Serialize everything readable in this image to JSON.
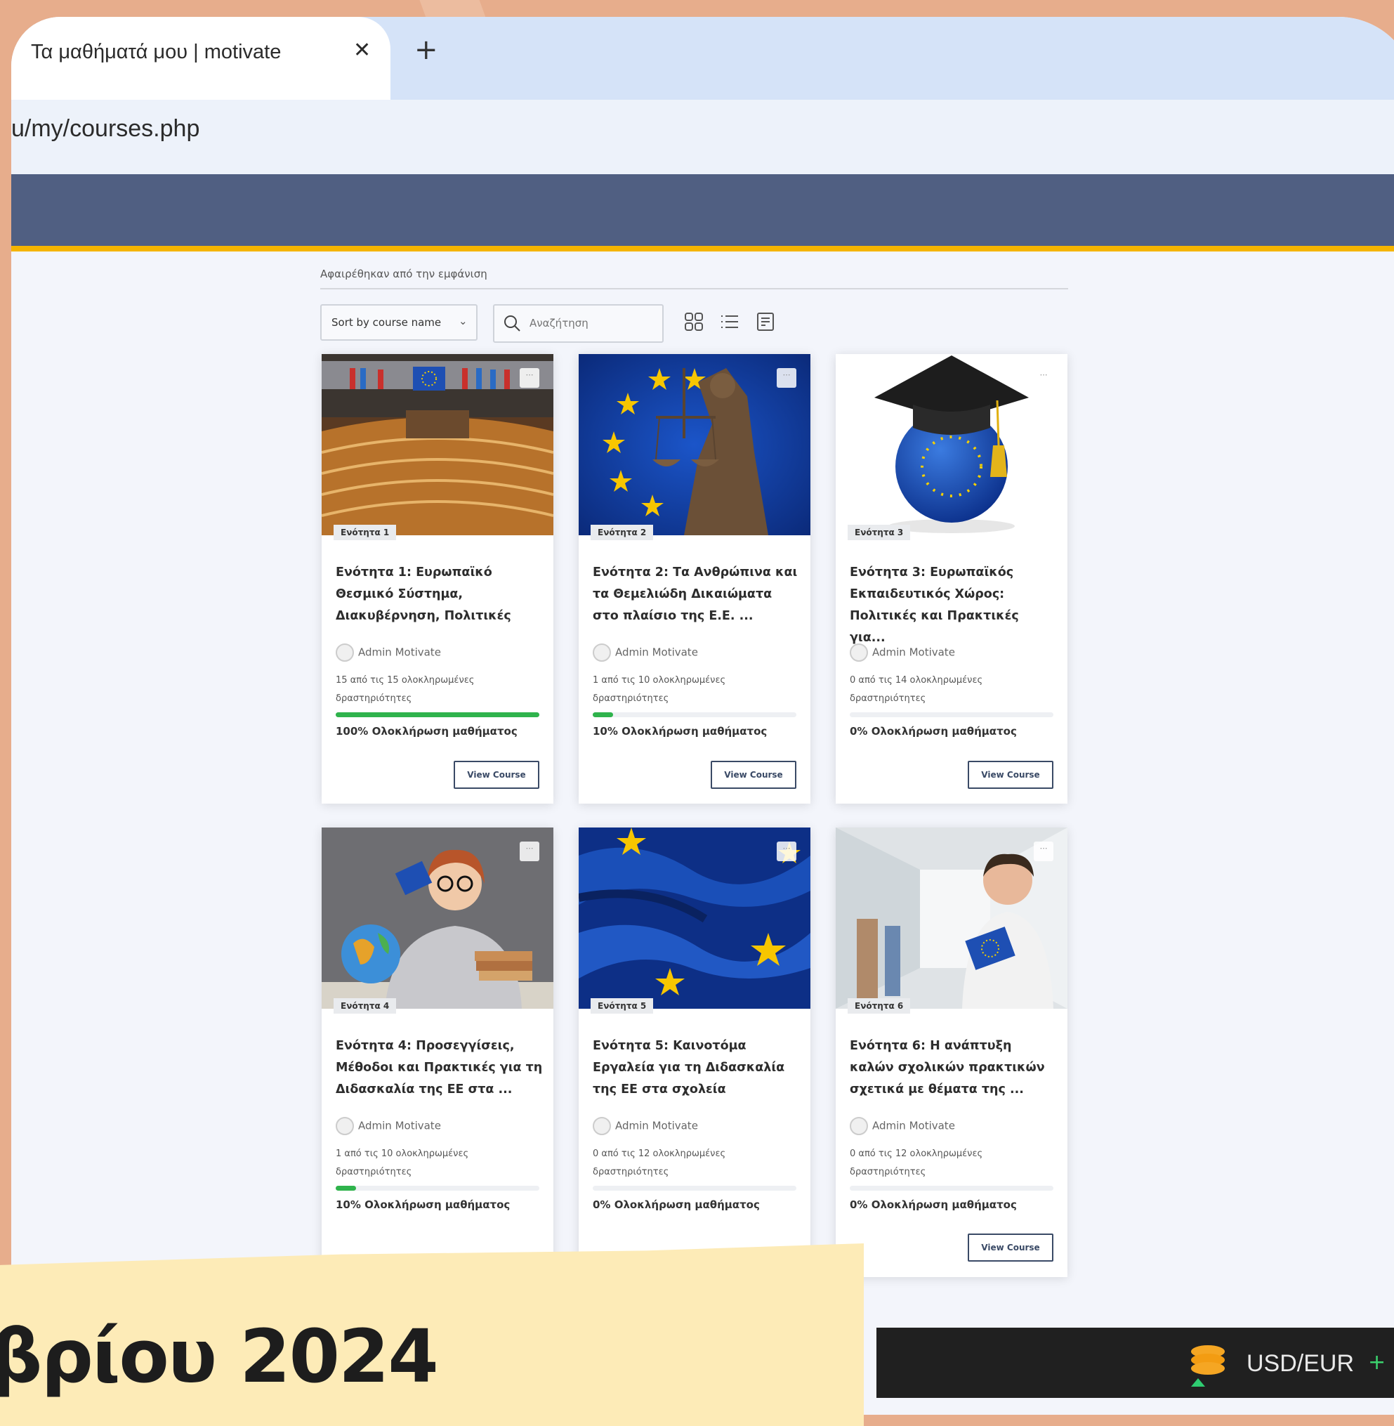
{
  "browser": {
    "tab_title": "Τα μαθήματά μου | motivate",
    "close_glyph": "✕",
    "new_tab_glyph": "+",
    "url": "u/my/courses.php"
  },
  "toolbar": {
    "removed_label": "Αφαιρέθηκαν από την εμφάνιση",
    "sort_label": "Sort by course name",
    "sort_chevron": "⌄",
    "search_placeholder": "Αναζήτηση"
  },
  "courses": [
    {
      "badge": "Ενότητα 1",
      "title": "Ενότητα 1: Ευρωπαϊκό Θεσμικό Σύστημα, Διακυβέρνηση, Πολιτικές",
      "author": "Admin Motivate",
      "activities": "15 από τις 15 ολοκληρωμένες δραστηριότητες",
      "progress": 100,
      "completion": "100% Ολοκλήρωση μαθήματος",
      "button": "View Course",
      "image": "eu-parliament"
    },
    {
      "badge": "Ενότητα 2",
      "title": "Ενότητα 2: Τα Ανθρώπινα και τα Θεμελιώδη Δικαιώματα στο πλαίσιο της Ε.Ε. ...",
      "author": "Admin Motivate",
      "activities": "1 από τις 10 ολοκληρωμένες δραστηριότητες",
      "progress": 10,
      "completion": "10% Ολοκλήρωση μαθήματος",
      "button": "View Course",
      "image": "lady-justice"
    },
    {
      "badge": "Ενότητα 3",
      "title": "Ενότητα 3: Ευρωπαϊκός Εκπαιδευτικός Χώρος: Πολιτικές και Πρακτικές για...",
      "author": "Admin Motivate",
      "activities": "0 από τις 14 ολοκληρωμένες δραστηριότητες",
      "progress": 0,
      "completion": "0% Ολοκλήρωση μαθήματος",
      "button": "View Course",
      "image": "eu-globe-cap"
    },
    {
      "badge": "Ενότητα 4",
      "title": "Ενότητα 4: Προσεγγίσεις, Μέθοδοι και Πρακτικές για τη Διδασκαλία της ΕΕ στα ...",
      "author": "Admin Motivate",
      "activities": "1 από τις 10 ολοκληρωμένες δραστηριότητες",
      "progress": 10,
      "completion": "10% Ολοκλήρωση μαθήματος",
      "button": "",
      "image": "teacher-globe"
    },
    {
      "badge": "Ενότητα 5",
      "title": "Ενότητα 5: Καινοτόμα Εργαλεία για τη Διδασκαλία της ΕΕ στα σχολεία",
      "author": "Admin Motivate",
      "activities": "0 από τις 12 ολοκληρωμένες δραστηριότητες",
      "progress": 0,
      "completion": "0% Ολοκλήρωση μαθήματος",
      "button": "",
      "image": "eu-flag"
    },
    {
      "badge": "Ενότητα 6",
      "title": "Ενότητα 6: Η ανάπτυξη καλών σχολικών πρακτικών σχετικά με θέματα της ...",
      "author": "Admin Motivate",
      "activities": "0 από τις 12 ολοκληρωμένες δραστηριότητες",
      "progress": 0,
      "completion": "0% Ολοκλήρωση μαθήματος",
      "button": "View Course",
      "image": "student-flag"
    }
  ],
  "overlay": {
    "date_text": "βρίου 2024"
  },
  "taskbar": {
    "ticker": "USD/EUR",
    "ticker_change": "+"
  },
  "colors": {
    "navbar": "#505f82",
    "accent_line": "#f5b400",
    "progress": "#2fb34c",
    "outer_background": "#e7ad8c",
    "banner": "#fdebb7"
  }
}
